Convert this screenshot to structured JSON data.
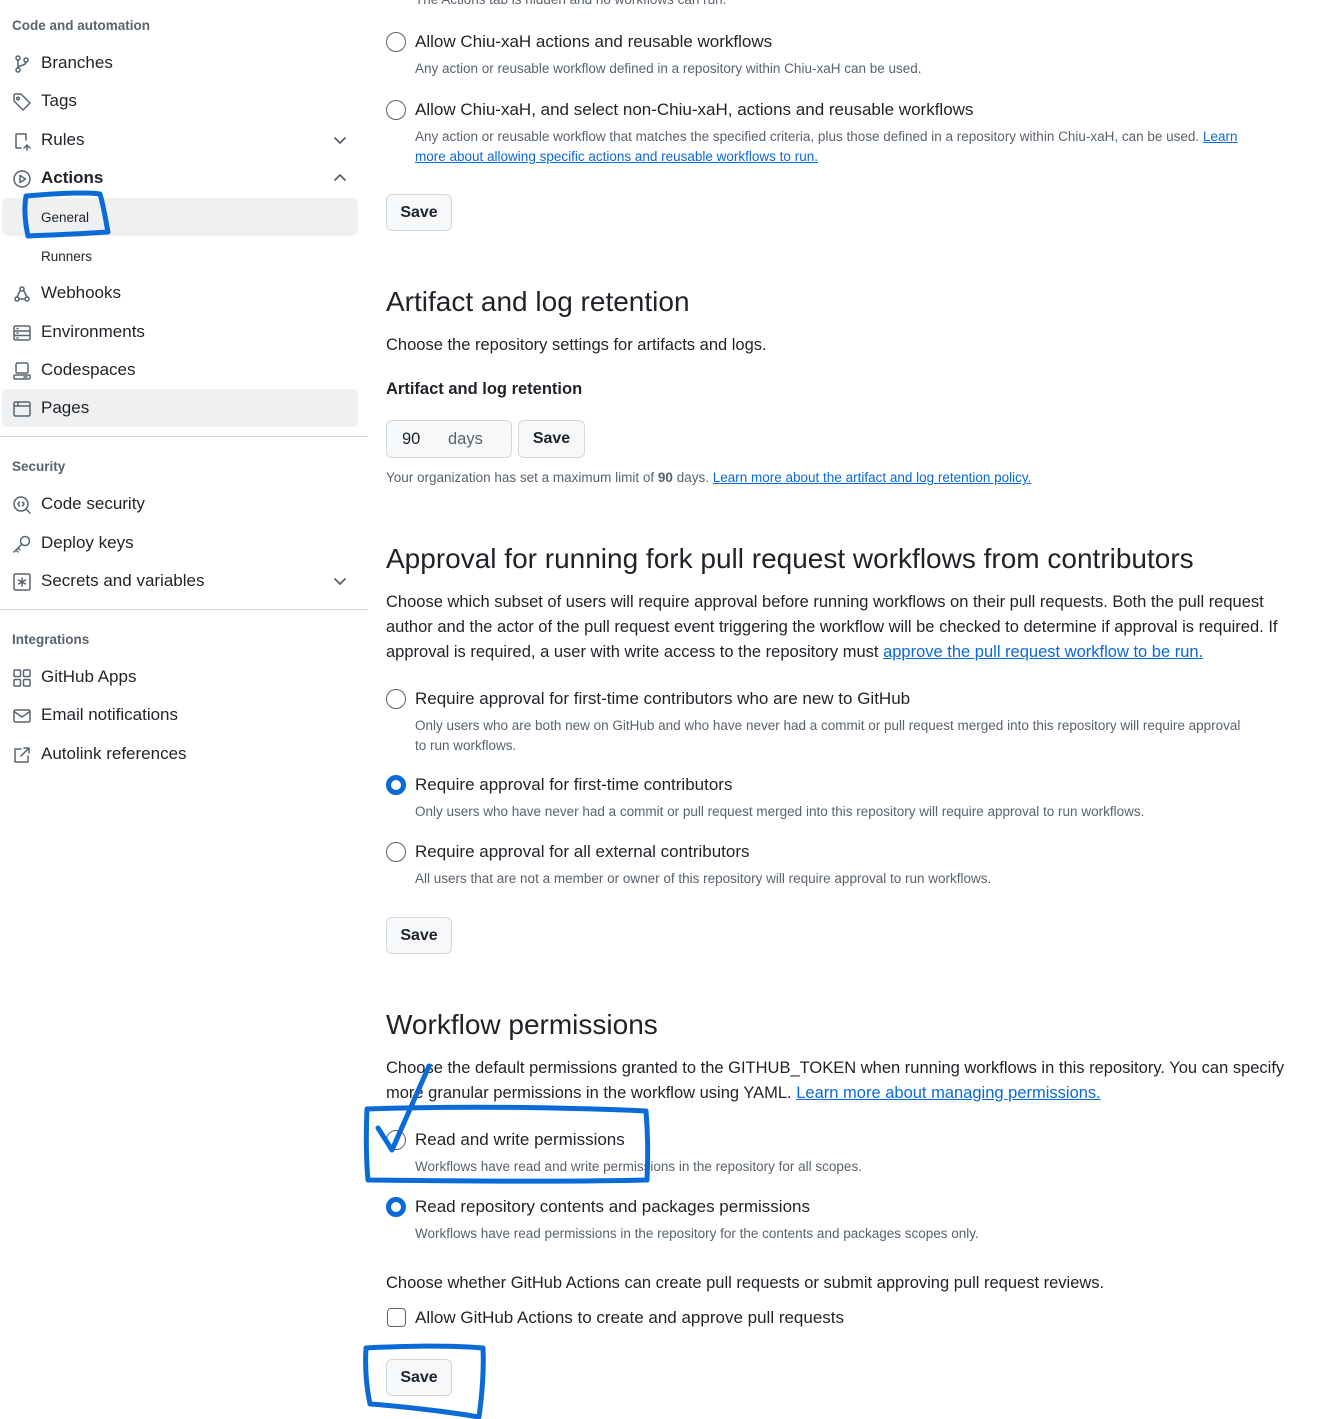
{
  "colors": {
    "accent": "#0969da",
    "annotation": "#0b6bd6",
    "muted": "#59636e"
  },
  "sidebar": {
    "code_heading": "Code and automation",
    "items_code": [
      {
        "label": "Branches",
        "icon": "git-branch-icon"
      },
      {
        "label": "Tags",
        "icon": "tag-icon"
      },
      {
        "label": "Rules",
        "icon": "rules-icon"
      },
      {
        "label": "Actions",
        "icon": "play-icon"
      }
    ],
    "actions_sub": [
      "General",
      "Runners"
    ],
    "items_more": [
      {
        "label": "Webhooks",
        "icon": "webhook-icon"
      },
      {
        "label": "Environments",
        "icon": "server-icon"
      },
      {
        "label": "Codespaces",
        "icon": "codespaces-icon"
      },
      {
        "label": "Pages",
        "icon": "browser-icon"
      }
    ],
    "security_heading": "Security",
    "items_security": [
      {
        "label": "Code security",
        "icon": "codescan-icon"
      },
      {
        "label": "Deploy keys",
        "icon": "key-icon"
      },
      {
        "label": "Secrets and variables",
        "icon": "asterisk-icon"
      }
    ],
    "integrations_heading": "Integrations",
    "items_integrations": [
      {
        "label": "GitHub Apps",
        "icon": "apps-icon"
      },
      {
        "label": "Email notifications",
        "icon": "mail-icon"
      },
      {
        "label": "Autolink references",
        "icon": "link-external-icon"
      }
    ]
  },
  "policy": {
    "cut_text": "The Actions tab is hidden and no workflows can run.",
    "opt_org_label": "Allow Chiu-xaH actions and reusable workflows",
    "opt_org_desc": "Any action or reusable workflow defined in a repository within Chiu-xaH can be used.",
    "opt_select_label": "Allow Chiu-xaH, and select non-Chiu-xaH, actions and reusable workflows",
    "opt_select_desc_1": "Any action or reusable workflow that matches the specified criteria, plus those defined in a repository within Chiu-xaH, can be used.",
    "opt_select_link_1": "Learn",
    "opt_select_link_2": "more about allowing specific actions and reusable workflows to run.",
    "save": "Save"
  },
  "retention": {
    "title": "Artifact and log retention",
    "desc": "Choose the repository settings for artifacts and logs.",
    "field_label": "Artifact and log retention",
    "value": "90",
    "unit": "days",
    "save": "Save",
    "note_pre": "Your organization has set a maximum limit of",
    "note_num": "90",
    "note_mid": "days.",
    "note_link": "Learn more about the artifact and log retention policy."
  },
  "approval": {
    "title": "Approval for running fork pull request workflows from contributors",
    "desc_1": "Choose which subset of users will require approval before running workflows on their pull requests. Both the pull request",
    "desc_2": "author and the actor of the pull request event triggering the workflow will be checked to determine if approval is required. If",
    "desc_3": "approval is required, a user with write access to the repository must",
    "desc_link": "approve the pull request workflow to be run.",
    "opt1_label": "Require approval for first-time contributors who are new to GitHub",
    "opt1_desc_1": "Only users who are both new on GitHub and who have never had a commit or pull request merged into this repository will require approval",
    "opt1_desc_2": "to run workflows.",
    "opt2_label": "Require approval for first-time contributors",
    "opt2_desc": "Only users who have never had a commit or pull request merged into this repository will require approval to run workflows.",
    "opt3_label": "Require approval for all external contributors",
    "opt3_desc": "All users that are not a member or owner of this repository will require approval to run workflows.",
    "save": "Save"
  },
  "workflow": {
    "title": "Workflow permissions",
    "desc_1": "Choose the default permissions granted to the GITHUB_TOKEN when running workflows in this repository. You can specify",
    "desc_2": "more granular permissions in the workflow using YAML.",
    "desc_link": "Learn more about managing permissions.",
    "opt_rw_label": "Read and write permissions",
    "opt_rw_desc": "Workflows have read and write permissions in the repository for all scopes.",
    "opt_r_label": "Read repository contents and packages permissions",
    "opt_r_desc": "Workflows have read permissions in the repository for the contents and packages scopes only.",
    "pr_question": "Choose whether GitHub Actions can create pull requests or submit approving pull request reviews.",
    "pr_checkbox_label": "Allow GitHub Actions to create and approve pull requests",
    "save": "Save"
  }
}
